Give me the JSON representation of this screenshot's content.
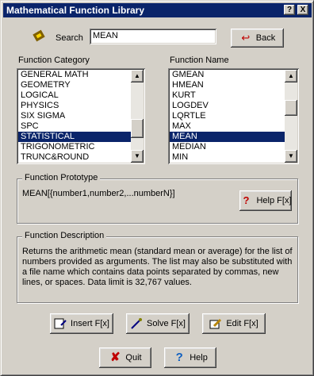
{
  "window": {
    "title": "Mathematical Function Library",
    "help_btn": "?",
    "close_btn": "X"
  },
  "search": {
    "label": "Search",
    "value": "MEAN",
    "back_label": "Back"
  },
  "category": {
    "label": "Function Category",
    "items": [
      "GENERAL MATH",
      "GEOMETRY",
      "LOGICAL",
      "PHYSICS",
      "SIX SIGMA",
      "SPC",
      "STATISTICAL",
      "TRIGONOMETRIC",
      "TRUNC&ROUND"
    ],
    "selected": "STATISTICAL"
  },
  "function_name": {
    "label": "Function Name",
    "items": [
      "GMEAN",
      "HMEAN",
      "KURT",
      "LOGDEV",
      "LQRTLE",
      "MAX",
      "MEAN",
      "MEDIAN",
      "MIN"
    ],
    "selected": "MEAN"
  },
  "prototype": {
    "label": "Function Prototype",
    "text": "MEAN[{number1,number2,...numberN}]",
    "help_label": "Help F[x]"
  },
  "description": {
    "label": "Function Description",
    "text": "Returns the arithmetic mean (standard mean or average) for the list of numbers provided as arguments. The list may also be substituted with a file name which contains data points separated by commas, new lines, or spaces. Data limit is 32,767 values."
  },
  "actions": {
    "insert": "Insert F[x]",
    "solve": "Solve F[x]",
    "edit": "Edit F[x]",
    "quit": "Quit",
    "help": "Help"
  },
  "colors": {
    "titlebar": "#0a246a",
    "selection": "#0a246a",
    "face": "#d4d0c8"
  }
}
